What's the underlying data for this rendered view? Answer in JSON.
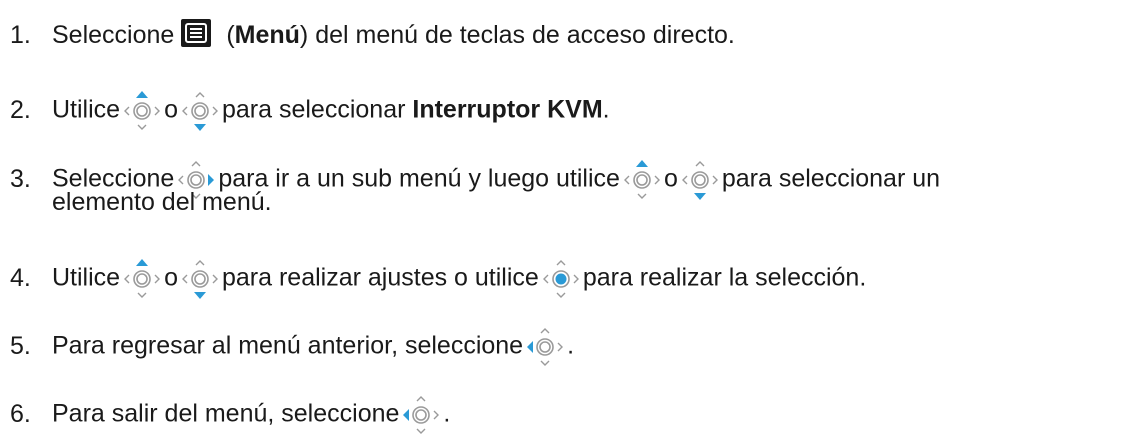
{
  "accent_color": "#2a9ad6",
  "icons": {
    "menu": "menu-list-icon",
    "up": "joystick-up-icon",
    "down": "joystick-down-icon",
    "right": "joystick-right-icon",
    "left": "joystick-left-icon",
    "center": "joystick-center-icon"
  },
  "steps": [
    {
      "number": "1.",
      "pre": "Seleccione",
      "paren_open": "(",
      "bold": "Menú",
      "post": ") del menú de teclas de acceso directo."
    },
    {
      "number": "2.",
      "pre": "Utilice",
      "or": "o",
      "mid": "para seleccionar",
      "bold": "Interruptor KVM",
      "end": "."
    },
    {
      "number": "3.",
      "pre": "Seleccione",
      "mid": "para ir a un sub menú y luego utilice",
      "or": "o",
      "post": "para seleccionar un",
      "cont": "elemento del menú."
    },
    {
      "number": "4.",
      "pre": "Utilice",
      "or": "o",
      "mid": "para realizar ajustes o utilice",
      "post": "para realizar la selección."
    },
    {
      "number": "5.",
      "pre": "Para regresar al menú anterior, seleccione",
      "end": "."
    },
    {
      "number": "6.",
      "pre": "Para salir del menú, seleccione",
      "end": "."
    }
  ]
}
